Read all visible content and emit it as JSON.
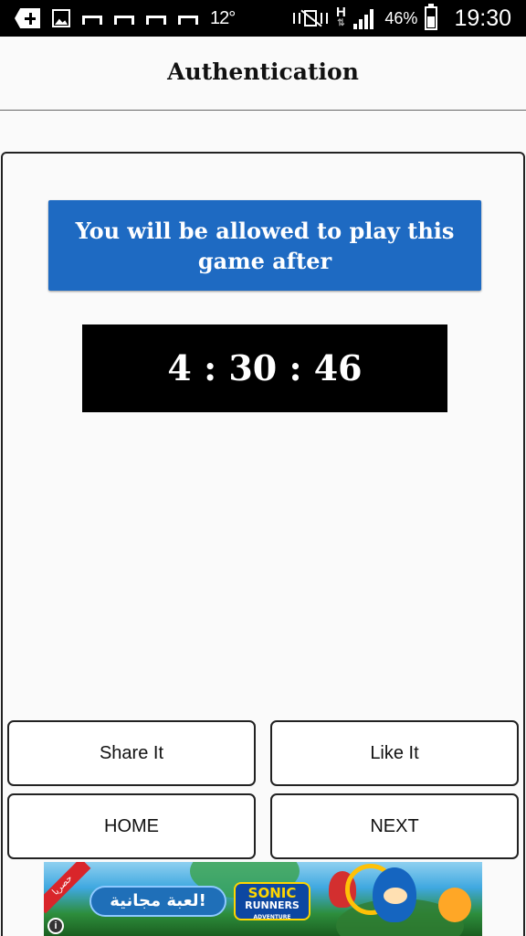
{
  "status_bar": {
    "temperature": "12°",
    "network_type": "H",
    "battery_percent": "46%",
    "battery_level": 0.46,
    "time": "19:30",
    "icons": [
      "add-notification-icon",
      "gallery-icon",
      "bracket-icon",
      "bracket-icon",
      "bracket-icon",
      "bracket-icon",
      "vibrate-off-icon",
      "network-h-icon",
      "signal-icon",
      "battery-icon"
    ]
  },
  "header": {
    "title": "Authentication"
  },
  "main": {
    "notice_text": "You will be allowed to play this game after",
    "countdown": "4 : 30 : 46"
  },
  "buttons": {
    "share_label": "Share It",
    "like_label": "Like It",
    "home_label": "HOME",
    "next_label": "NEXT"
  },
  "ad": {
    "ribbon_text": "حصريا",
    "cta_text": "لعبة مجانية!",
    "logo_line1": "SONIC",
    "logo_line2": "RUNNERS",
    "logo_line3": "ADVENTURE",
    "info_glyph": "i"
  },
  "colors": {
    "notice_bg": "#1e6ac2",
    "timer_bg": "#000000",
    "status_bar_bg": "#000000",
    "page_bg": "#fafafa"
  }
}
